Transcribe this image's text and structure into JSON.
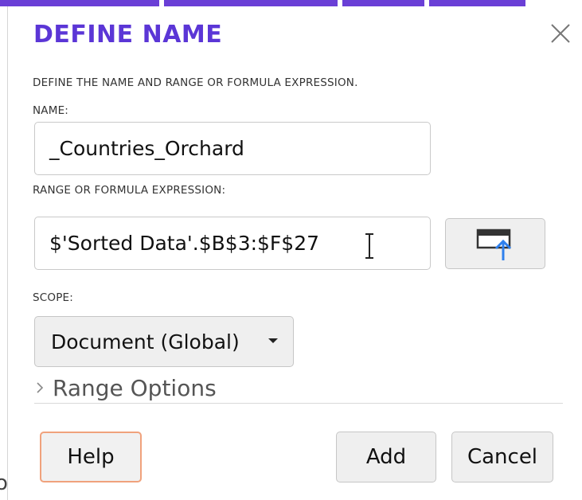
{
  "dialog": {
    "title": "DEFINE NAME",
    "description": "DEFINE THE NAME AND RANGE OR FORMULA EXPRESSION.",
    "name_label": "NAME:",
    "name_value": "_Countries_Orchard",
    "range_label": "RANGE OR FORMULA EXPRESSION:",
    "range_value": "$'Sorted Data'.$B$3:$F$27",
    "scope_label": "SCOPE:",
    "scope_value": "Document (Global)",
    "range_options_label": "Range Options",
    "buttons": {
      "help": "Help",
      "add": "Add",
      "cancel": "Cancel"
    }
  },
  "background": {
    "left_edge_char": "o"
  },
  "icons": {
    "close": "close-icon",
    "shrink": "shrink-dialog-icon",
    "dropdown": "chevron-down-icon",
    "expander": "chevron-right-icon",
    "cursor": "text-cursor-icon"
  },
  "colors": {
    "accent": "#5b36d6",
    "help_focus_border": "#f0a27c",
    "shrink_arrow": "#2f80ed"
  }
}
